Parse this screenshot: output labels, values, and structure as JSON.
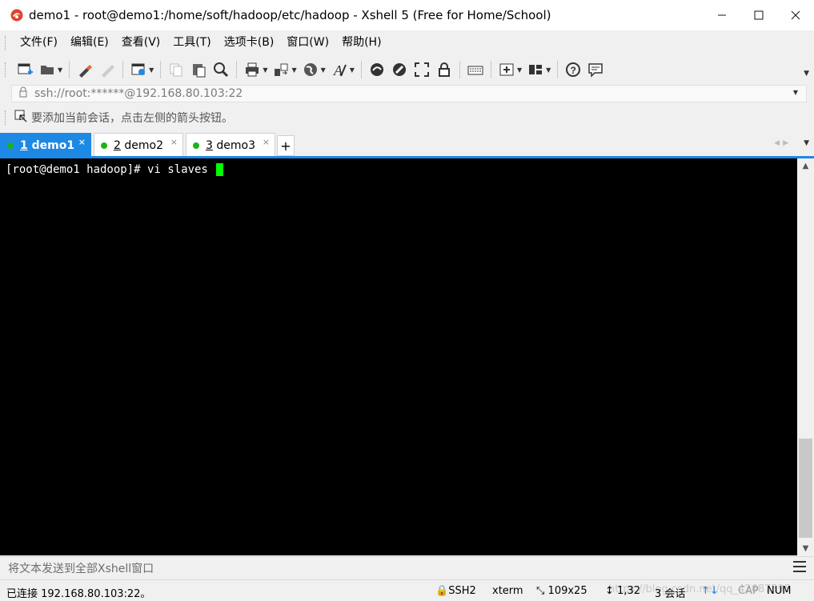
{
  "window": {
    "title": "demo1 - root@demo1:/home/soft/hadoop/etc/hadoop - Xshell 5 (Free for Home/School)",
    "minimize_icon": "minimize-icon",
    "maximize_icon": "maximize-icon",
    "close_icon": "close-icon"
  },
  "menu": {
    "items": [
      "文件(F)",
      "编辑(E)",
      "查看(V)",
      "工具(T)",
      "选项卡(B)",
      "窗口(W)",
      "帮助(H)"
    ]
  },
  "toolbar": {
    "icons": [
      "new-session-icon",
      "open-folder-icon",
      "reconnect-icon",
      "disconnect-icon",
      "new-window-icon",
      "copy-icon",
      "paste-icon",
      "find-icon",
      "print-icon",
      "transfer-icon",
      "globe-icon",
      "font-icon",
      "xftp-icon",
      "xmanager-icon",
      "fullscreen-icon",
      "lock-icon",
      "keyboard-icon",
      "add-icon",
      "layout-icon",
      "help-icon",
      "chat-icon"
    ]
  },
  "address": {
    "value": "ssh://root:******@192.168.80.103:22"
  },
  "hint": {
    "text": "要添加当前会话，点击左侧的箭头按钮。"
  },
  "tabs": [
    {
      "num": "1",
      "label": "demo1",
      "active": true
    },
    {
      "num": "2",
      "label": "demo2",
      "active": false
    },
    {
      "num": "3",
      "label": "demo3",
      "active": false
    }
  ],
  "tab_close_glyph": "×",
  "tab_add_glyph": "+",
  "terminal": {
    "prompt": "[root@demo1 hadoop]# vi slaves "
  },
  "compose": {
    "placeholder": "将文本发送到全部Xshell窗口"
  },
  "status": {
    "connection": "已连接 192.168.80.103:22。",
    "protocol": "SSH2",
    "term": "xterm",
    "size": "109x25",
    "cursor_pos": "1,32",
    "sessions": "3 会话",
    "caps": "CAP",
    "num": "NUM",
    "watermark": "https://blog.csdn.net/qq_42687595"
  },
  "colors": {
    "accent": "#1e88e5",
    "session_dot": "#1bb31b",
    "cursor": "#00ff00",
    "terminal_bg": "#000000"
  }
}
